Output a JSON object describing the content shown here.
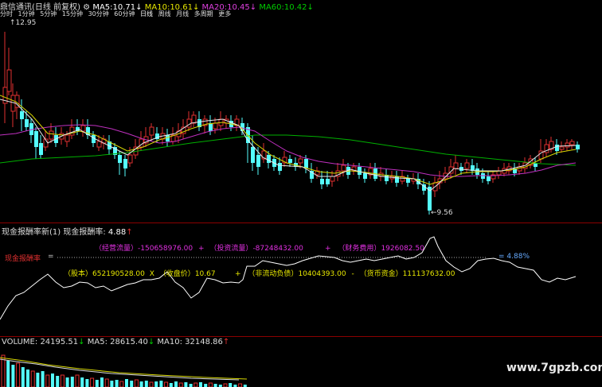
{
  "header": {
    "title": "鼎信通讯(日线 前复权)",
    "ma5_label": "MA5:",
    "ma5_value": "10.71",
    "ma10_label": "MA10:",
    "ma10_value": "10.61",
    "ma20_label": "MA20:",
    "ma20_value": "10.45",
    "ma60_label": "MA60:",
    "ma60_value": "10.42",
    "colors": {
      "ma5": "#ffffff",
      "ma10": "#e6e600",
      "ma20": "#e040e0",
      "ma60": "#00cc00"
    }
  },
  "period_bar": [
    "分时",
    "1分钟",
    "5分钟",
    "15分钟",
    "30分钟",
    "60分钟",
    "日线",
    "周线",
    "月线",
    "多周期",
    "更多"
  ],
  "price_panel": {
    "high_label": "12.95",
    "low_label": "9.56"
  },
  "indicator": {
    "title": "现金报酬率新(1)",
    "name": "现金报酬率:",
    "value": "4.88",
    "formula_label": "现金报酬率",
    "formula_eq": "=",
    "op_cash_label": "（经营流量）",
    "op_cash_value": "-150658976.00",
    "plus": "+",
    "inv_cash_label": "（投资流量）",
    "inv_cash_value": "-87248432.00",
    "fin_cost_label": "（财务费用）",
    "fin_cost_value": "1926082.50",
    "result": "= 4.88%",
    "shares_label": "（股本）",
    "shares_value": "652190528.00",
    "times": "X",
    "close_label": "（收盘价）",
    "close_value": "10.67",
    "noncurr_label": "（非流动负债）",
    "noncurr_value": "10404393.00",
    "minus": "-",
    "cash_label": "（货币资金）",
    "cash_value": "111137632.00"
  },
  "volume": {
    "label": "VOLUME:",
    "value": "24195.51",
    "ma5_label": "MA5:",
    "ma5_value": "28615.40",
    "ma10_label": "MA10:",
    "ma10_value": "32148.86"
  },
  "watermark": "www.7gpzb.com"
}
